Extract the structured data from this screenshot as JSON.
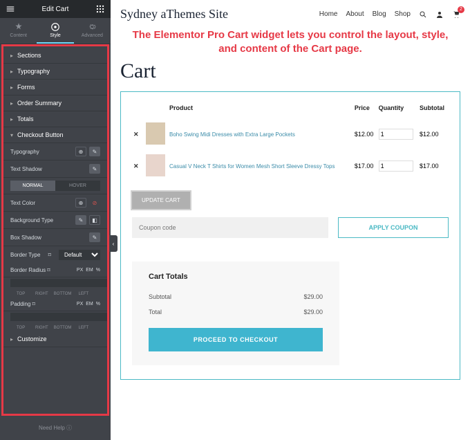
{
  "sidebar": {
    "title": "Edit Cart",
    "tabs": {
      "content": "Content",
      "style": "Style",
      "advanced": "Advanced"
    },
    "sections": {
      "sections": "Sections",
      "typography": "Typography",
      "forms": "Forms",
      "order_summary": "Order Summary",
      "totals": "Totals",
      "checkout_btn": "Checkout Button",
      "customize": "Customize"
    },
    "controls": {
      "typography": "Typography",
      "text_shadow": "Text Shadow",
      "normal": "NORMAL",
      "hover": "HOVER",
      "text_color": "Text Color",
      "background_type": "Background Type",
      "box_shadow": "Box Shadow",
      "border_type": "Border Type",
      "border_type_val": "Default",
      "border_radius": "Border Radius",
      "padding": "Padding",
      "px": "PX",
      "em": "EM",
      "pct": "%",
      "top": "TOP",
      "right": "RIGHT",
      "bottom": "BOTTOM",
      "left": "LEFT"
    },
    "help": "Need Help"
  },
  "header": {
    "site_title": "Sydney aThemes Site",
    "nav": {
      "home": "Home",
      "about": "About",
      "blog": "Blog",
      "shop": "Shop"
    },
    "cart_count": "2"
  },
  "callout": "The Elementor Pro Cart widget lets you control the layout, style, and content of the Cart page.",
  "page_title": "Cart",
  "cart": {
    "headers": {
      "product": "Product",
      "price": "Price",
      "quantity": "Quantity",
      "subtotal": "Subtotal"
    },
    "items": [
      {
        "name": "Boho Swing Midi Dresses with Extra Large Pockets",
        "price": "$12.00",
        "qty": "1",
        "sub": "$12.00"
      },
      {
        "name": "Casual V Neck T Shirts for Women Mesh Short Sleeve Dressy Tops",
        "price": "$17.00",
        "qty": "1",
        "sub": "$17.00"
      }
    ],
    "update": "UPDATE CART",
    "coupon_ph": "Coupon code",
    "apply": "APPLY COUPON"
  },
  "totals": {
    "title": "Cart Totals",
    "subtotal_label": "Subtotal",
    "subtotal": "$29.00",
    "total_label": "Total",
    "total": "$29.00",
    "checkout": "PROCEED TO CHECKOUT"
  }
}
